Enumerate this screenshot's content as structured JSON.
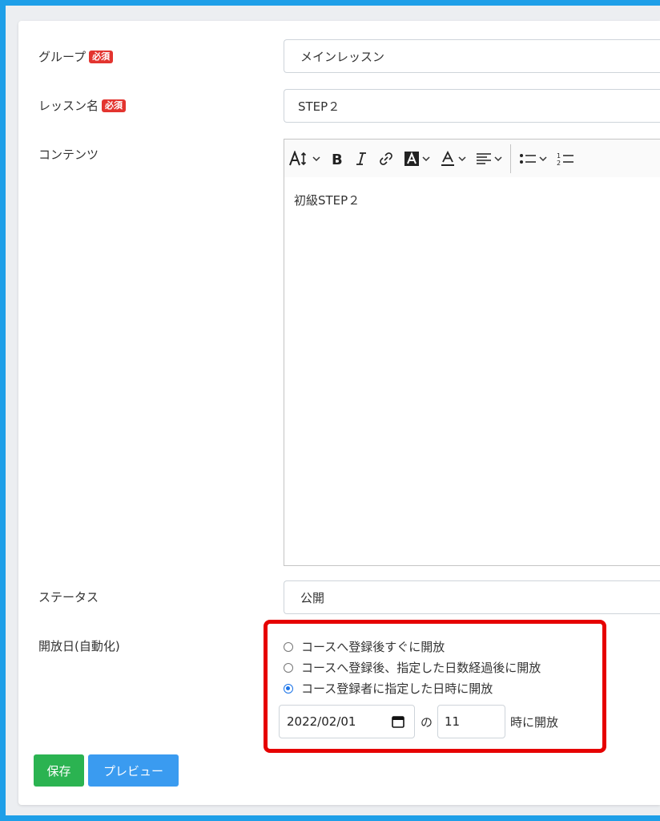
{
  "form": {
    "group": {
      "label": "グループ",
      "required": "必須",
      "value": "メインレッスン"
    },
    "lesson_name": {
      "label": "レッスン名",
      "required": "必須",
      "value": "STEP２"
    },
    "contents": {
      "label": "コンテンツ",
      "body": "初級STEP２"
    },
    "status": {
      "label": "ステータス",
      "value": "公開"
    },
    "open_date": {
      "label": "開放日(自動化)",
      "options": [
        {
          "label": "コースへ登録後すぐに開放",
          "checked": false
        },
        {
          "label": "コースへ登録後、指定した日数経過後に開放",
          "checked": false
        },
        {
          "label": "コース登録者に指定した日時に開放",
          "checked": true
        }
      ],
      "date_value": "2022/02/01",
      "connector": "の",
      "hour_value": "11",
      "suffix": "時に開放"
    }
  },
  "toolbar": {
    "items": [
      "font-size-icon",
      "bold-icon",
      "italic-icon",
      "link-icon",
      "highlight-icon",
      "font-color-icon",
      "align-icon",
      "bullet-list-icon",
      "numbered-list-icon"
    ]
  },
  "buttons": {
    "save": "保存",
    "preview": "プレビュー"
  },
  "colors": {
    "highlight_border": "#e60000",
    "save": "#2bb351",
    "preview": "#3a9bf0",
    "badge": "#e3342f"
  }
}
